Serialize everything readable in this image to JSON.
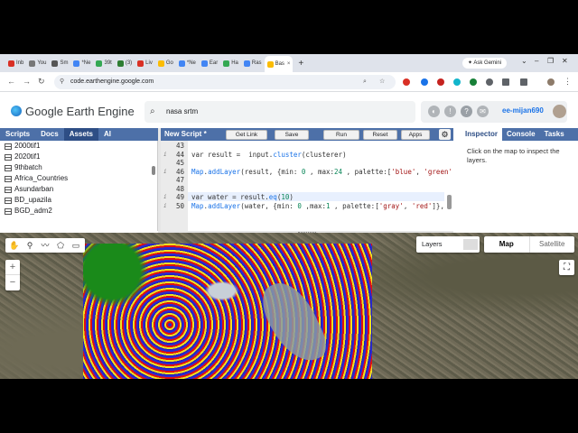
{
  "browser": {
    "tabs": [
      {
        "label": "Inb",
        "color": "#d93025"
      },
      {
        "label": "You",
        "color": "#777777"
      },
      {
        "label": "Sm",
        "color": "#555555"
      },
      {
        "label": "*Ne",
        "color": "#4285f4"
      },
      {
        "label": "39t",
        "color": "#34a853"
      },
      {
        "label": "(3)",
        "color": "#2e7d32"
      },
      {
        "label": "Liv",
        "color": "#d93025"
      },
      {
        "label": "Go",
        "color": "#fbbc04"
      },
      {
        "label": "*Ne",
        "color": "#4285f4"
      },
      {
        "label": "Ear",
        "color": "#4285f4"
      },
      {
        "label": "Ha",
        "color": "#34a853"
      },
      {
        "label": "Ras",
        "color": "#4285f4"
      },
      {
        "label": "Bas",
        "color": "#fbbc04"
      }
    ],
    "active_tab_close": "×",
    "new_tab": "+",
    "gemini_label": "Ask Gemini",
    "url": "code.earthengine.google.com"
  },
  "gee": {
    "title": "Google Earth Engine",
    "search_value": "nasa srtm",
    "user": "ee-mijan690",
    "left_tabs": [
      "Scripts",
      "Docs",
      "Assets",
      "AI"
    ],
    "assets": [
      "2000tif1",
      "2020tif1",
      "9thbatch",
      "Africa_Countries",
      "Asundarban",
      "BD_upazila",
      "BGD_adm2"
    ],
    "editor": {
      "title": "New Script *",
      "buttons": {
        "get_link": "Get Link",
        "save": "Save",
        "run": "Run",
        "reset": "Reset",
        "apps": "Apps"
      },
      "lines": [
        {
          "num": "43",
          "info": "",
          "code": ""
        },
        {
          "num": "44",
          "info": "i",
          "code": "var result =  input.cluster(clusterer)"
        },
        {
          "num": "45",
          "info": "",
          "code": ""
        },
        {
          "num": "46",
          "info": "i",
          "code": "Map.addLayer(result, {min: 0 , max:24 , palette:['blue', 'green'"
        },
        {
          "num": "47",
          "info": "",
          "code": ""
        },
        {
          "num": "48",
          "info": "",
          "code": ""
        },
        {
          "num": "49",
          "info": "i",
          "code": "var water = result.eq(10)"
        },
        {
          "num": "50",
          "info": "i",
          "code": "Map.addLayer(water, {min: 0 ,max:1 , palette:['gray', 'red']},"
        }
      ]
    },
    "right_tabs": [
      "Inspector",
      "Console",
      "Tasks"
    ],
    "inspector_hint": "Click on the map to inspect the layers.",
    "map": {
      "layers_label": "Layers",
      "map_type": "Map",
      "satellite": "Satellite",
      "zoom_in": "+",
      "zoom_out": "−"
    }
  }
}
